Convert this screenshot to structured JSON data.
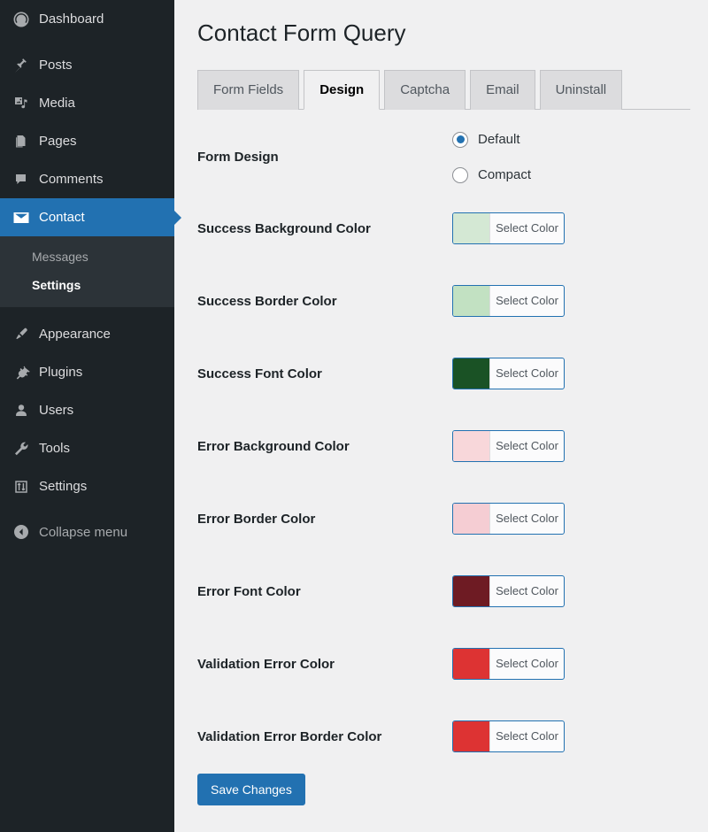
{
  "sidebar": {
    "items": [
      {
        "label": "Dashboard",
        "icon": "dashboard-icon",
        "current": false
      },
      {
        "label": "Posts",
        "icon": "pin-icon",
        "current": false
      },
      {
        "label": "Media",
        "icon": "media-icon",
        "current": false
      },
      {
        "label": "Pages",
        "icon": "pages-icon",
        "current": false
      },
      {
        "label": "Comments",
        "icon": "comment-icon",
        "current": false
      },
      {
        "label": "Contact",
        "icon": "envelope-icon",
        "current": true
      },
      {
        "label": "Appearance",
        "icon": "brush-icon",
        "current": false
      },
      {
        "label": "Plugins",
        "icon": "plug-icon",
        "current": false
      },
      {
        "label": "Users",
        "icon": "user-icon",
        "current": false
      },
      {
        "label": "Tools",
        "icon": "wrench-icon",
        "current": false
      },
      {
        "label": "Settings",
        "icon": "sliders-icon",
        "current": false
      }
    ],
    "submenu": [
      {
        "label": "Messages",
        "current": false
      },
      {
        "label": "Settings",
        "current": true
      }
    ],
    "collapse": {
      "label": "Collapse menu",
      "icon": "arrow-left-circle-icon"
    },
    "colors": {
      "background": "#1d2327",
      "submenu_background": "#2c3338",
      "current_background": "#2271b1",
      "text": "#dcdcde",
      "muted_text": "#a7aaad"
    }
  },
  "header": {
    "title": "Contact Form Query"
  },
  "tabs": [
    {
      "label": "Form Fields",
      "active": false
    },
    {
      "label": "Design",
      "active": true
    },
    {
      "label": "Captcha",
      "active": false
    },
    {
      "label": "Email",
      "active": false
    },
    {
      "label": "Uninstall",
      "active": false
    }
  ],
  "form": {
    "design": {
      "label": "Form Design",
      "options": [
        {
          "label": "Default",
          "checked": true
        },
        {
          "label": "Compact",
          "checked": false
        }
      ]
    },
    "select_color_label": "Select Color",
    "color_rows": [
      {
        "label": "Success Background Color",
        "color": "#d4e8d4"
      },
      {
        "label": "Success Border Color",
        "color": "#c2e1c2"
      },
      {
        "label": "Success Font Color",
        "color": "#1a5225"
      },
      {
        "label": "Error Background Color",
        "color": "#f8d7da"
      },
      {
        "label": "Error Border Color",
        "color": "#f5cdd3"
      },
      {
        "label": "Error Font Color",
        "color": "#6e1b23"
      },
      {
        "label": "Validation Error Color",
        "color": "#dd3333"
      },
      {
        "label": "Validation Error Border Color",
        "color": "#dd3333"
      }
    ],
    "save_label": "Save Changes"
  },
  "theme": {
    "accent": "#2271b1",
    "content_background": "#f0f0f1",
    "tab_inactive_background": "#dcdcde",
    "border": "#c3c4c7"
  }
}
